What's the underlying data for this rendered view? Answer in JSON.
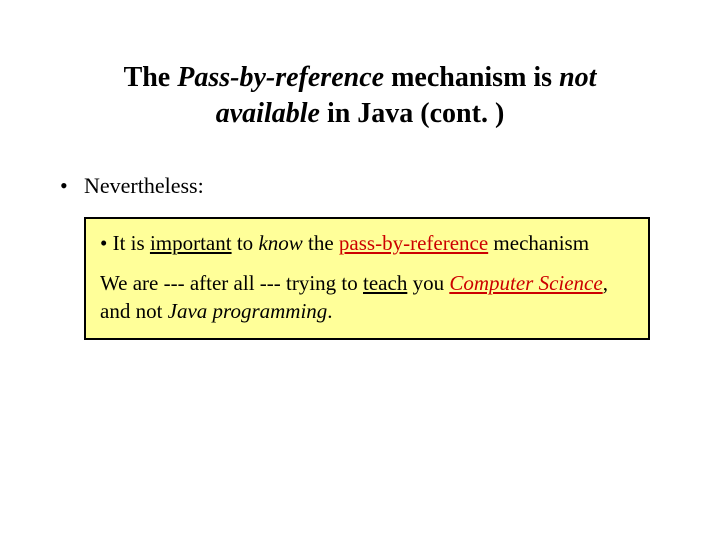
{
  "title": {
    "t1": "The ",
    "t2": "Pass-by-reference",
    "t3": " mechanism is ",
    "t4": "not available",
    "t5": " in Java (cont. )"
  },
  "bullet": {
    "dot": "•",
    "text": "Nevertheless:"
  },
  "box": {
    "p1": {
      "a": "• It is ",
      "b": "important",
      "c": " to ",
      "d": "know",
      "e": " the ",
      "f": "pass-by-reference",
      "g": " mechanism"
    },
    "p2": {
      "a": "We are --- after all --- trying to ",
      "b": "teach",
      "c": " you ",
      "d": "Computer Science",
      "e": ", and not ",
      "f": "Java programming",
      "g": "."
    }
  }
}
